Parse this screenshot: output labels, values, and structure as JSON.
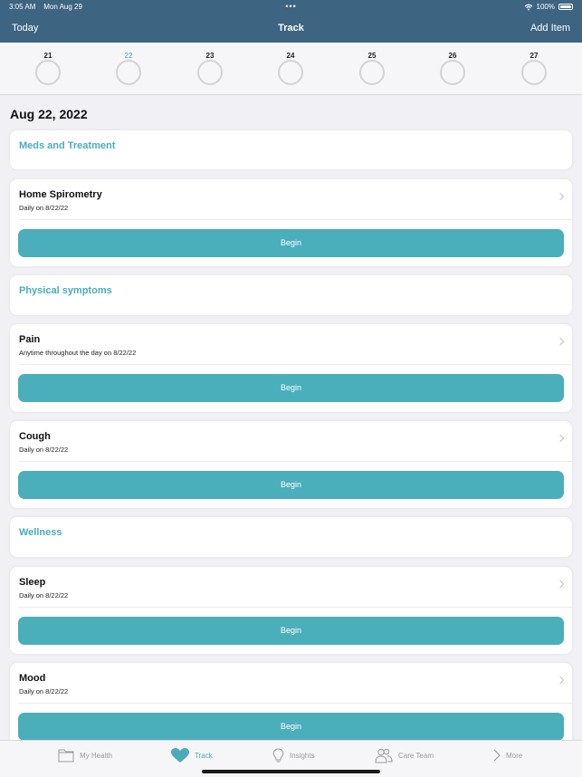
{
  "status": {
    "time": "3:05 AM",
    "date": "Mon Aug 29",
    "battery": "100%"
  },
  "nav": {
    "left": "Today",
    "title": "Track",
    "right": "Add Item"
  },
  "calendar": {
    "days": [
      {
        "num": "21",
        "active": false
      },
      {
        "num": "22",
        "active": true
      },
      {
        "num": "23",
        "active": false
      },
      {
        "num": "24",
        "active": false
      },
      {
        "num": "25",
        "active": false
      },
      {
        "num": "26",
        "active": false
      },
      {
        "num": "27",
        "active": false
      }
    ]
  },
  "date_heading": "Aug 22, 2022",
  "sections": {
    "meds": "Meds and Treatment",
    "physical": "Physical symptoms",
    "wellness": "Wellness"
  },
  "items": {
    "spirometry": {
      "title": "Home Spirometry",
      "sub": "Daily on 8/22/22",
      "button": "Begin"
    },
    "pain": {
      "title": "Pain",
      "sub": "Anytime throughout the day on 8/22/22",
      "button": "Begin"
    },
    "cough": {
      "title": "Cough",
      "sub": "Daily on 8/22/22",
      "button": "Begin"
    },
    "sleep": {
      "title": "Sleep",
      "sub": "Daily on 8/22/22",
      "button": "Begin"
    },
    "mood": {
      "title": "Mood",
      "sub": "Daily on 8/22/22",
      "button": "Begin"
    }
  },
  "tabs": {
    "my_health": "My Health",
    "track": "Track",
    "insights": "Insights",
    "care_team": "Care Team",
    "more": "More"
  },
  "colors": {
    "nav_bg": "#3d6481",
    "accent": "#4aabbb",
    "button": "#4aaebb"
  },
  "icons": [
    "wifi-icon",
    "battery-icon",
    "folder-icon",
    "heart-icon",
    "lightbulb-icon",
    "people-icon",
    "chevron-right-icon"
  ]
}
